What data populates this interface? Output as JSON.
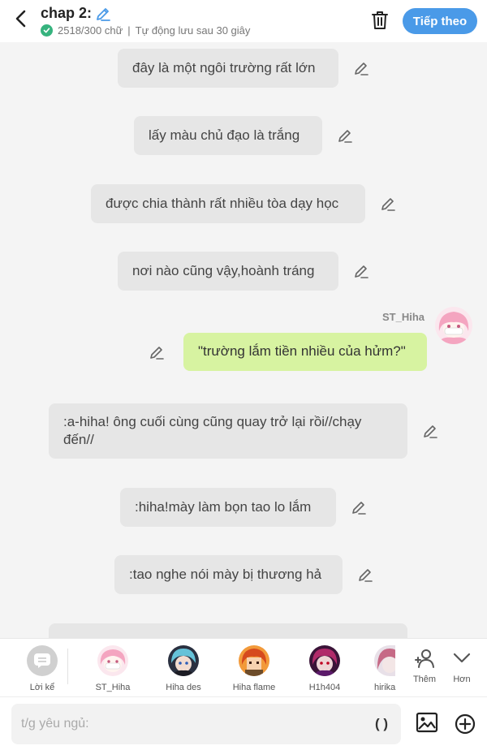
{
  "header": {
    "title": "chap 2:",
    "word_count": "2518/300 chữ",
    "separator": "|",
    "autosave": "Tự động lưu sau 30 giây",
    "next_label": "Tiếp theo",
    "accent": "#4a9ae8"
  },
  "messages": [
    {
      "text": "đây là một ngôi trường rất lớn",
      "type": "narration"
    },
    {
      "text": "lấy màu chủ đạo là trắng",
      "type": "narration"
    },
    {
      "text": "được chia thành rất nhiều tòa dạy học",
      "type": "narration"
    },
    {
      "text": "nơi nào cũng vậy,hoành tráng",
      "type": "narration"
    },
    {
      "sender": "ST_Hiha",
      "text": "\"trường lắm tiền nhiều của hửm?\"",
      "type": "character"
    },
    {
      "text": ":a-hiha! ông cuối cùng cũng quay trở lại rồi//chạy đến//",
      "type": "narration"
    },
    {
      "text": ":hiha!mày làm bọn tao lo lắm",
      "type": "narration"
    },
    {
      "text": ":tao nghe nói mày bị thương hả",
      "type": "narration"
    }
  ],
  "characters": {
    "narrator": "Lời kể",
    "items": [
      "ST_Hiha",
      "Hiha des",
      "Hiha flame",
      "H1h404",
      "hirika"
    ],
    "add_label": "Thêm",
    "more_label": "Hơn"
  },
  "input": {
    "placeholder": "t/g yêu ngủ:",
    "paren_label": "( )"
  },
  "colors": {
    "bubble": "#e6e6e6",
    "character_bubble": "#d7f3a1",
    "check": "#36b37e"
  },
  "icons": [
    "back-arrow-icon",
    "pencil-icon",
    "check-icon",
    "trash-icon",
    "edit-pencil-icon",
    "narrator-icon",
    "add-person-icon",
    "chevron-down-icon",
    "image-icon",
    "plus-circle-icon"
  ]
}
